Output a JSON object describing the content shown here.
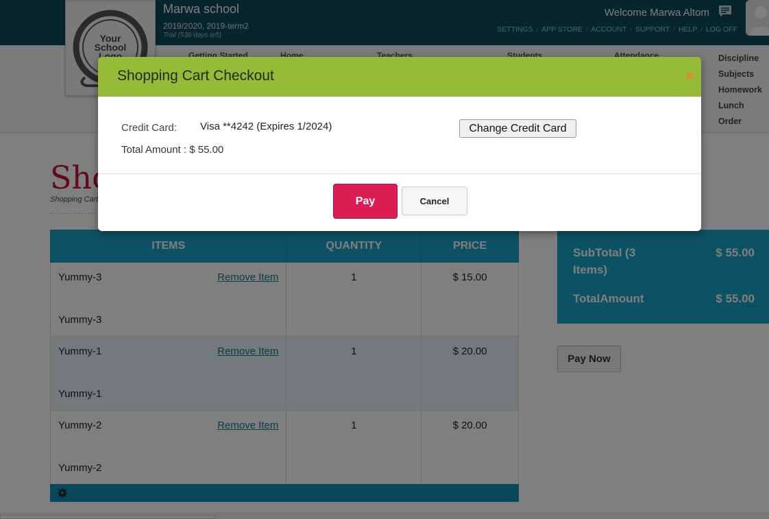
{
  "header": {
    "logo_lines": [
      "Your",
      "School",
      "Logo"
    ],
    "school_name": "Marwa school",
    "school_year": "2019/2020, 2019-term2",
    "trial": "Trial (538 days left)",
    "welcome": "Welcome Marwa Altom",
    "links": [
      "SETTINGS",
      "APP STORE",
      "ACCOUNT",
      "SUPPORT",
      "HELP",
      "LOG OFF"
    ],
    "link_separator": "/"
  },
  "nav": {
    "items": [
      "Getting Started",
      "Home",
      "Teachers",
      "Students",
      "Attendance"
    ],
    "side_items": [
      "Discipline",
      "Subjects",
      "Homework",
      "Lunch Order"
    ]
  },
  "page": {
    "title": "Shopping Cart",
    "subtitle": "Shopping Cart"
  },
  "cart": {
    "columns": [
      "ITEMS",
      "QUANTITY",
      "PRICE"
    ],
    "remove_label": "Remove Item",
    "rows": [
      {
        "name": "Yummy-3",
        "sub": "Yummy-3",
        "qty": "1",
        "price": "$ 15.00"
      },
      {
        "name": "Yummy-1",
        "sub": "Yummy-1",
        "qty": "1",
        "price": "$ 20.00"
      },
      {
        "name": "Yummy-2",
        "sub": "Yummy-2",
        "qty": "1",
        "price": "$ 20.00"
      }
    ]
  },
  "summary": {
    "subtotal_label": "SubTotal (3 Items)",
    "subtotal_value": "$ 55.00",
    "total_label": "TotalAmount",
    "total_value": "$ 55.00",
    "pay_now": "Pay Now"
  },
  "modal": {
    "title": "Shopping Cart Checkout",
    "close": "×",
    "credit_card_label": "Credit Card:",
    "credit_card_value": "Visa **4242 (Expires 1/2024)",
    "total_amount": "Total Amount : $ 55.00",
    "change_card": "Change Credit Card",
    "pay": "Pay",
    "cancel": "Cancel"
  },
  "colors": {
    "header_bg": "#0c4a5e",
    "accent_blue": "#1aa3c9",
    "modal_header": "#94ba38",
    "pay_button": "#dc1c55",
    "title_red": "#c8103c",
    "close_orange": "#f07f1a"
  },
  "icons": {
    "message": "speech-bubble-icon",
    "avatar": "user-silhouette-icon",
    "gear": "gear-icon"
  }
}
